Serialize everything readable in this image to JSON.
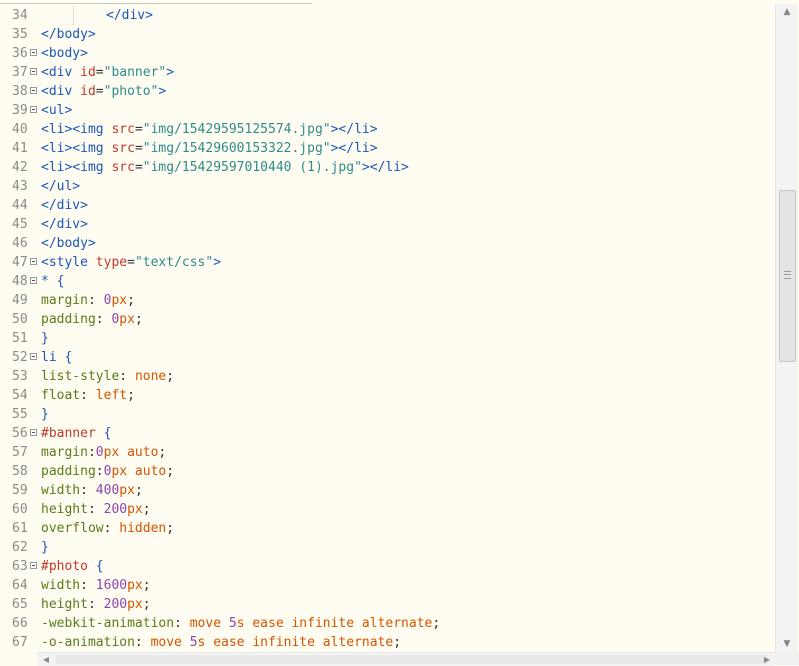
{
  "editor": {
    "lines": [
      {
        "n": "34",
        "fold": false,
        "guide": true,
        "tokens": [
          {
            "t": "</div>",
            "c": "tag"
          }
        ]
      },
      {
        "n": "35",
        "fold": false,
        "tokens": [
          {
            "t": "</body>",
            "c": "tag"
          }
        ]
      },
      {
        "n": "36",
        "fold": true,
        "tokens": [
          {
            "t": "<body>",
            "c": "tag"
          }
        ]
      },
      {
        "n": "37",
        "fold": true,
        "tokens": [
          {
            "t": "<div ",
            "c": "tag"
          },
          {
            "t": "id",
            "c": "attr"
          },
          {
            "t": "=",
            "c": "punc"
          },
          {
            "t": "\"banner\"",
            "c": "str"
          },
          {
            "t": ">",
            "c": "tag"
          }
        ]
      },
      {
        "n": "38",
        "fold": true,
        "tokens": [
          {
            "t": "<div ",
            "c": "tag"
          },
          {
            "t": "id",
            "c": "attr"
          },
          {
            "t": "=",
            "c": "punc"
          },
          {
            "t": "\"photo\"",
            "c": "str"
          },
          {
            "t": ">",
            "c": "tag"
          }
        ]
      },
      {
        "n": "39",
        "fold": true,
        "tokens": [
          {
            "t": "<ul>",
            "c": "tag"
          }
        ]
      },
      {
        "n": "40",
        "fold": false,
        "tokens": [
          {
            "t": "<li><img ",
            "c": "tag"
          },
          {
            "t": "src",
            "c": "attr"
          },
          {
            "t": "=",
            "c": "punc"
          },
          {
            "t": "\"img/15429595125574.jpg\"",
            "c": "str"
          },
          {
            "t": "></li>",
            "c": "tag"
          }
        ]
      },
      {
        "n": "41",
        "fold": false,
        "tokens": [
          {
            "t": "<li><img ",
            "c": "tag"
          },
          {
            "t": "src",
            "c": "attr"
          },
          {
            "t": "=",
            "c": "punc"
          },
          {
            "t": "\"img/15429600153322.jpg\"",
            "c": "str"
          },
          {
            "t": "></li>",
            "c": "tag"
          }
        ]
      },
      {
        "n": "42",
        "fold": false,
        "tokens": [
          {
            "t": "<li><img ",
            "c": "tag"
          },
          {
            "t": "src",
            "c": "attr"
          },
          {
            "t": "=",
            "c": "punc"
          },
          {
            "t": "\"img/15429597010440 (1).jpg\"",
            "c": "str"
          },
          {
            "t": "></li>",
            "c": "tag"
          }
        ]
      },
      {
        "n": "43",
        "fold": false,
        "tokens": [
          {
            "t": "</ul>",
            "c": "tag"
          }
        ]
      },
      {
        "n": "44",
        "fold": false,
        "tokens": [
          {
            "t": "</div>",
            "c": "tag"
          }
        ]
      },
      {
        "n": "45",
        "fold": false,
        "tokens": [
          {
            "t": "</div>",
            "c": "tag"
          }
        ]
      },
      {
        "n": "46",
        "fold": false,
        "tokens": [
          {
            "t": "</body>",
            "c": "tag"
          }
        ]
      },
      {
        "n": "47",
        "fold": true,
        "tokens": [
          {
            "t": "<style ",
            "c": "tag"
          },
          {
            "t": "type",
            "c": "attr"
          },
          {
            "t": "=",
            "c": "punc"
          },
          {
            "t": "\"text/css\"",
            "c": "str"
          },
          {
            "t": ">",
            "c": "tag"
          }
        ]
      },
      {
        "n": "48",
        "fold": true,
        "tokens": [
          {
            "t": "* {",
            "c": "sel"
          }
        ]
      },
      {
        "n": "49",
        "fold": false,
        "tokens": [
          {
            "t": "margin",
            "c": "prop"
          },
          {
            "t": ": ",
            "c": "punc"
          },
          {
            "t": "0",
            "c": "num"
          },
          {
            "t": "px",
            "c": "val"
          },
          {
            "t": ";",
            "c": "punc"
          }
        ]
      },
      {
        "n": "50",
        "fold": false,
        "tokens": [
          {
            "t": "padding",
            "c": "prop"
          },
          {
            "t": ": ",
            "c": "punc"
          },
          {
            "t": "0",
            "c": "num"
          },
          {
            "t": "px",
            "c": "val"
          },
          {
            "t": ";",
            "c": "punc"
          }
        ]
      },
      {
        "n": "51",
        "fold": false,
        "tokens": [
          {
            "t": "}",
            "c": "sel"
          }
        ]
      },
      {
        "n": "52",
        "fold": true,
        "tokens": [
          {
            "t": "li {",
            "c": "sel"
          }
        ]
      },
      {
        "n": "53",
        "fold": false,
        "tokens": [
          {
            "t": "list-style",
            "c": "prop"
          },
          {
            "t": ": ",
            "c": "punc"
          },
          {
            "t": "none",
            "c": "val"
          },
          {
            "t": ";",
            "c": "punc"
          }
        ]
      },
      {
        "n": "54",
        "fold": false,
        "tokens": [
          {
            "t": "float",
            "c": "prop"
          },
          {
            "t": ": ",
            "c": "punc"
          },
          {
            "t": "left",
            "c": "val"
          },
          {
            "t": ";",
            "c": "punc"
          }
        ]
      },
      {
        "n": "55",
        "fold": false,
        "tokens": [
          {
            "t": "}",
            "c": "sel"
          }
        ]
      },
      {
        "n": "56",
        "fold": true,
        "tokens": [
          {
            "t": "#banner",
            "c": "attr"
          },
          {
            "t": " {",
            "c": "sel"
          }
        ]
      },
      {
        "n": "57",
        "fold": false,
        "tokens": [
          {
            "t": "margin",
            "c": "prop"
          },
          {
            "t": ":",
            "c": "punc"
          },
          {
            "t": "0",
            "c": "num"
          },
          {
            "t": "px auto",
            "c": "val"
          },
          {
            "t": ";",
            "c": "punc"
          }
        ]
      },
      {
        "n": "58",
        "fold": false,
        "tokens": [
          {
            "t": "padding",
            "c": "prop"
          },
          {
            "t": ":",
            "c": "punc"
          },
          {
            "t": "0",
            "c": "num"
          },
          {
            "t": "px auto",
            "c": "val"
          },
          {
            "t": ";",
            "c": "punc"
          }
        ]
      },
      {
        "n": "59",
        "fold": false,
        "tokens": [
          {
            "t": "width",
            "c": "prop"
          },
          {
            "t": ": ",
            "c": "punc"
          },
          {
            "t": "400",
            "c": "num"
          },
          {
            "t": "px",
            "c": "val"
          },
          {
            "t": ";",
            "c": "punc"
          }
        ]
      },
      {
        "n": "60",
        "fold": false,
        "tokens": [
          {
            "t": "height",
            "c": "prop"
          },
          {
            "t": ": ",
            "c": "punc"
          },
          {
            "t": "200",
            "c": "num"
          },
          {
            "t": "px",
            "c": "val"
          },
          {
            "t": ";",
            "c": "punc"
          }
        ]
      },
      {
        "n": "61",
        "fold": false,
        "tokens": [
          {
            "t": "overflow",
            "c": "prop"
          },
          {
            "t": ": ",
            "c": "punc"
          },
          {
            "t": "hidden",
            "c": "val"
          },
          {
            "t": ";",
            "c": "punc"
          }
        ]
      },
      {
        "n": "62",
        "fold": false,
        "tokens": [
          {
            "t": "}",
            "c": "sel"
          }
        ]
      },
      {
        "n": "63",
        "fold": true,
        "tokens": [
          {
            "t": "#photo",
            "c": "attr"
          },
          {
            "t": " {",
            "c": "sel"
          }
        ]
      },
      {
        "n": "64",
        "fold": false,
        "tokens": [
          {
            "t": "width",
            "c": "prop"
          },
          {
            "t": ": ",
            "c": "punc"
          },
          {
            "t": "1600",
            "c": "num"
          },
          {
            "t": "px",
            "c": "val"
          },
          {
            "t": ";",
            "c": "punc"
          }
        ]
      },
      {
        "n": "65",
        "fold": false,
        "tokens": [
          {
            "t": "height",
            "c": "prop"
          },
          {
            "t": ": ",
            "c": "punc"
          },
          {
            "t": "200",
            "c": "num"
          },
          {
            "t": "px",
            "c": "val"
          },
          {
            "t": ";",
            "c": "punc"
          }
        ]
      },
      {
        "n": "66",
        "fold": false,
        "tokens": [
          {
            "t": "-webkit-animation",
            "c": "prop"
          },
          {
            "t": ": ",
            "c": "punc"
          },
          {
            "t": "move ",
            "c": "val"
          },
          {
            "t": "5",
            "c": "num"
          },
          {
            "t": "s ease infinite alternate",
            "c": "val"
          },
          {
            "t": ";",
            "c": "punc"
          }
        ]
      },
      {
        "n": "67",
        "fold": false,
        "tokens": [
          {
            "t": "-o-animation",
            "c": "prop"
          },
          {
            "t": ": ",
            "c": "punc"
          },
          {
            "t": "move ",
            "c": "val"
          },
          {
            "t": "5",
            "c": "num"
          },
          {
            "t": "s ease infinite alternate",
            "c": "val"
          },
          {
            "t": ";",
            "c": "punc"
          }
        ]
      }
    ]
  },
  "scrollbars": {
    "vertical_up_icon": "▲",
    "vertical_down_icon": "▼",
    "horizontal_left_icon": "◀",
    "horizontal_right_icon": "▶"
  }
}
